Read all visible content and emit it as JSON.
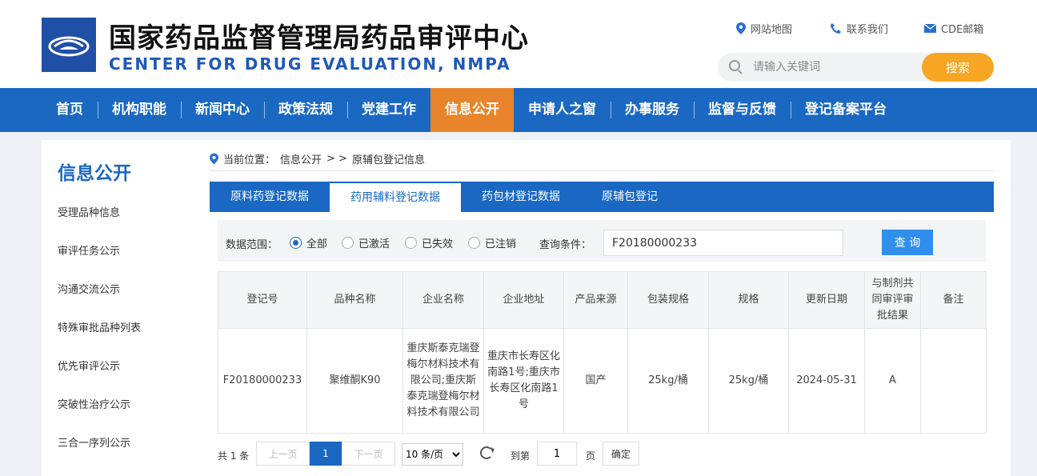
{
  "header": {
    "title_cn": "国家药品监督管理局药品审评中心",
    "title_en": "CENTER FOR DRUG EVALUATION, NMPA",
    "links": [
      "网站地图",
      "联系我们",
      "CDE邮箱"
    ],
    "search_placeholder": "请输入关键词",
    "search_button": "搜索"
  },
  "nav": {
    "items": [
      "首页",
      "机构职能",
      "新闻中心",
      "政策法规",
      "党建工作",
      "信息公开",
      "申请人之窗",
      "办事服务",
      "监督与反馈",
      "登记备案平台"
    ],
    "active": "信息公开"
  },
  "sidebar": {
    "title": "信息公开",
    "items": [
      "受理品种信息",
      "审评任务公示",
      "沟通交流公示",
      "特殊审批品种列表",
      "优先审评公示",
      "突破性治疗公示",
      "三合一序列公示"
    ]
  },
  "breadcrumb": {
    "prefix": "当前位置：",
    "path1": "信息公开",
    "separator": "> >",
    "path2": "原辅包登记信息"
  },
  "tabs": [
    "原料药登记数据",
    "药用辅料登记数据",
    "药包材登记数据",
    "原辅包登记"
  ],
  "filter": {
    "scope_label": "数据范围：",
    "options": [
      "全部",
      "已激活",
      "已失效",
      "已注销"
    ],
    "selected": "全部",
    "query_label": "查询条件：",
    "query_value": "F20180000233",
    "query_button": "查 询"
  },
  "table": {
    "headers": [
      "登记号",
      "品种名称",
      "企业名称",
      "企业地址",
      "产品来源",
      "包装规格",
      "规格",
      "更新日期",
      "与制剂共同审评审批结果",
      "备注"
    ],
    "rows": [
      [
        "F20180000233",
        "聚维酮K90",
        "重庆斯泰克瑞登梅尔材料技术有限公司;重庆斯泰克瑞登梅尔材料技术有限公司",
        "重庆市长寿区化南路1号;重庆市长寿区化南路1号",
        "国产",
        "25kg/桶",
        "25kg/桶",
        "2024-05-31",
        "A",
        ""
      ]
    ]
  },
  "pager": {
    "total": "共 1 条",
    "prev": "上一页",
    "current": "1",
    "next": "下一页",
    "page_size": "10 条/页",
    "goto_label": "到第",
    "goto_value": "1",
    "page_unit": "页",
    "confirm": "确定"
  },
  "colors": {
    "nav_blue": "#1a68c2",
    "active_orange": "#e8852c",
    "search_orange": "#f6a623"
  }
}
